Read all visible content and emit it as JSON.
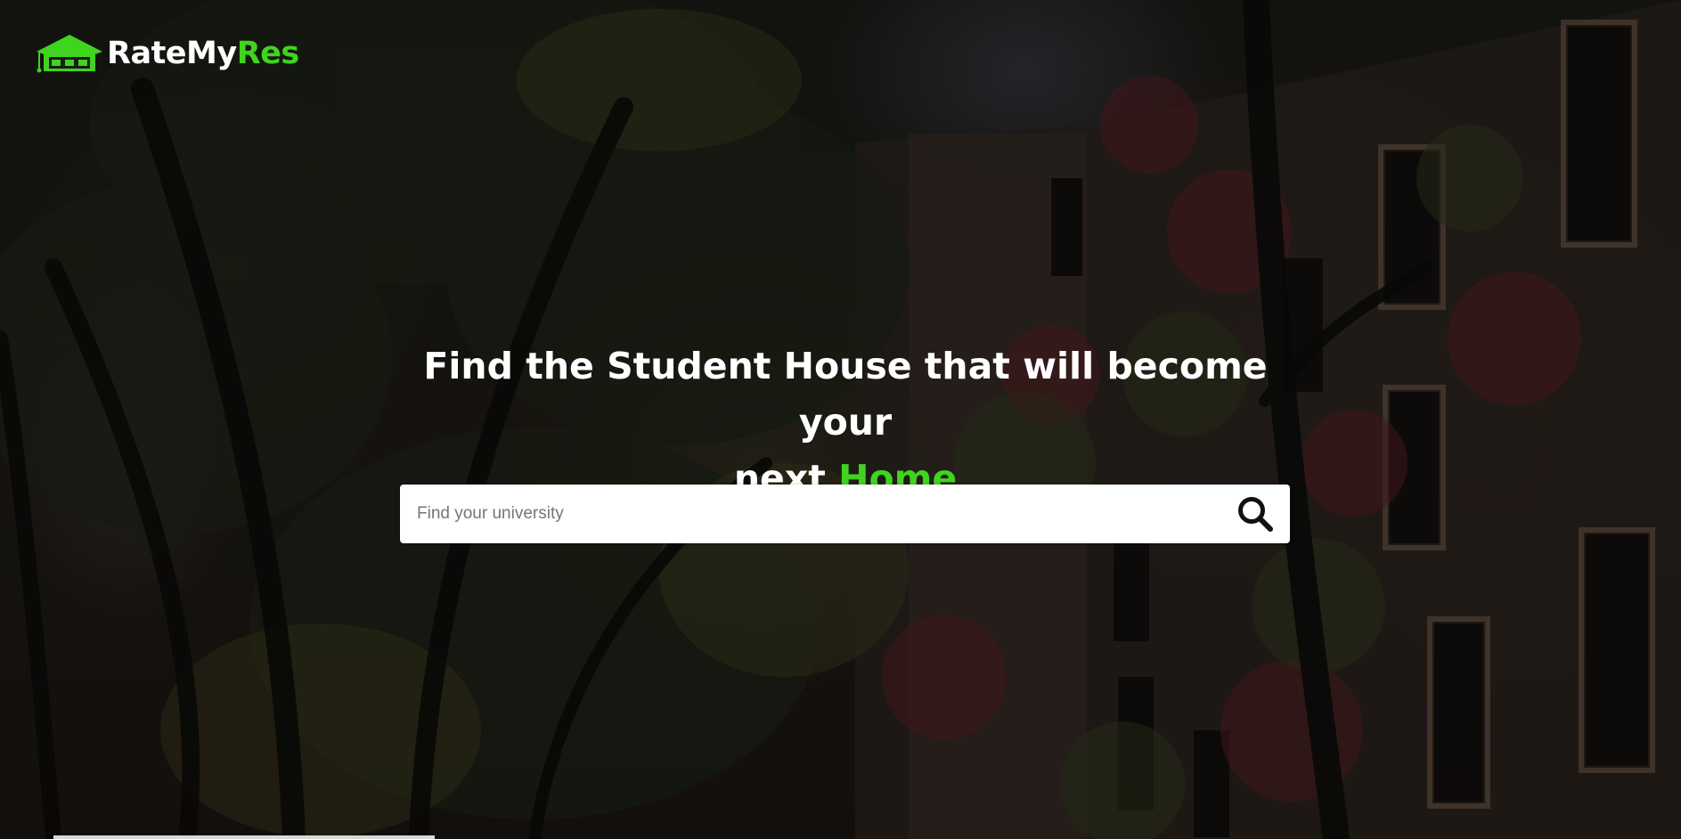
{
  "brand": {
    "name_part1": "RateMy",
    "name_part2": "Res",
    "logo_icon": "house-graduation-cap-icon",
    "accent_color": "#3fd41e"
  },
  "hero": {
    "headline_line1": "Find the Student House that will become your",
    "headline_line2_prefix": "next",
    "headline_line2_accent": "Home"
  },
  "search": {
    "placeholder": "Find your university",
    "value": "",
    "button_icon": "search-icon"
  }
}
